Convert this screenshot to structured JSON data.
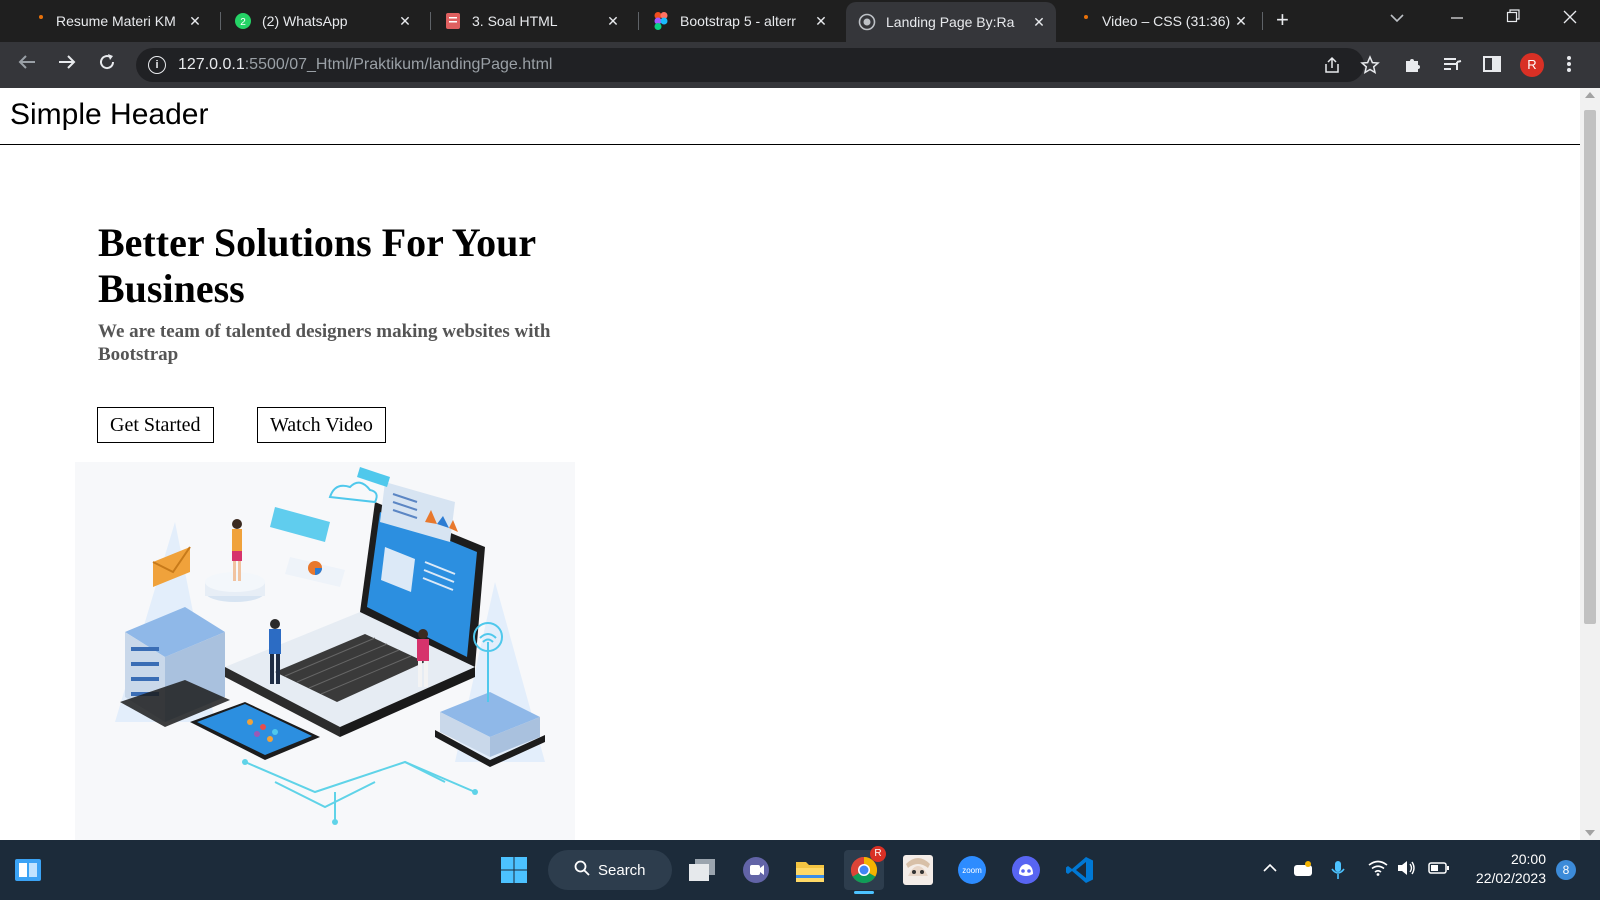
{
  "browser": {
    "tabs": [
      {
        "title": "Resume Materi KM",
        "icon": "document-icon"
      },
      {
        "title": "(2) WhatsApp",
        "icon": "whatsapp-icon"
      },
      {
        "title": "3. Soal HTML",
        "icon": "document-icon"
      },
      {
        "title": "Bootstrap 5 - alterr",
        "icon": "figma-icon"
      },
      {
        "title": "Landing Page By:Ra",
        "icon": "globe-icon",
        "active": true
      },
      {
        "title": "Video – CSS (31:36)",
        "icon": "video-icon"
      }
    ],
    "url_host": "127.0.0.1",
    "url_path": ":5500/07_Html/Praktikum/landingPage.html",
    "profile_initial": "R"
  },
  "page": {
    "header_title": "Simple Header",
    "hero_title": "Better Solutions For Your Business",
    "hero_subtitle": "We are team of talented designers making websites with Bootstrap",
    "btn_get_started": "Get Started",
    "btn_watch_video": "Watch Video"
  },
  "taskbar": {
    "search_label": "Search",
    "time": "20:00",
    "date": "22/02/2023",
    "notifications": "8",
    "zoom_label": "zoom",
    "chrome_badge": "R"
  },
  "colors": {
    "tab_bg": "#1f1f1f",
    "toolbar_bg": "#35363a",
    "taskbar_bg": "#1c2b3a",
    "accent_blue": "#3c8bd9"
  }
}
